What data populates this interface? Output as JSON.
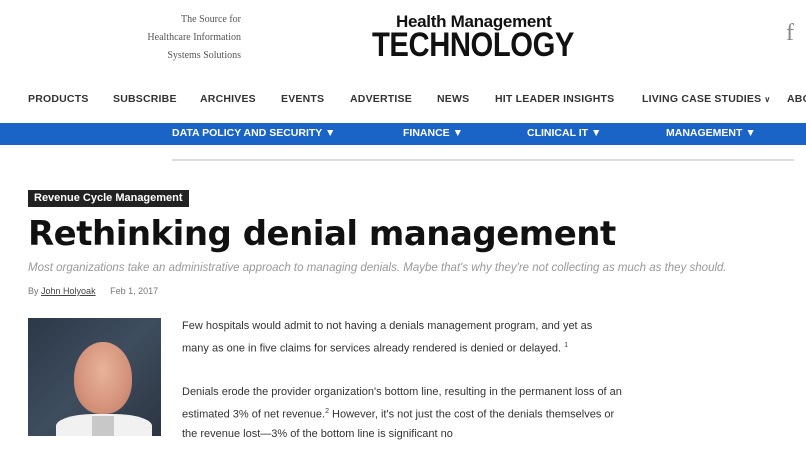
{
  "header": {
    "tagline": [
      "The Source for",
      "Healthcare Information",
      "Systems Solutions"
    ],
    "logo_top": "Health Management",
    "logo_bottom": "TECHNOLOGY",
    "social_icon": "f"
  },
  "main_nav": {
    "items": [
      "PRODUCTS",
      "SUBSCRIBE",
      "ARCHIVES",
      "EVENTS",
      "ADVERTISE",
      "NEWS",
      "HIT LEADER INSIGHTS",
      "LIVING CASE STUDIES",
      "ABO"
    ],
    "caret": "∨"
  },
  "category_nav": {
    "items": [
      "DATA POLICY AND SECURITY ▼",
      "FINANCE ▼",
      "CLINICAL IT ▼",
      "MANAGEMENT ▼"
    ]
  },
  "article": {
    "tag": "Revenue Cycle Management",
    "title": "Rethinking denial management",
    "subtitle": "Most organizations take an administrative approach to managing denials. Maybe that's why they're not collecting as much as they should.",
    "byline_prefix": "By",
    "author": "John Holyoak",
    "date": "Feb 1, 2017",
    "paragraphs": [
      {
        "text": "Few hospitals would admit to not having a denials management program, and yet as many as one in five claims for services already rendered is denied or delayed.",
        "sup": "1"
      },
      {
        "text_a": "Denials erode the provider organization's bottom line, resulting in the permanent loss of an estimated 3% of net revenue.",
        "sup": "2",
        "text_b": " However, it's not just the cost of the denials themselves or the revenue lost—3% of the bottom line is significant no"
      }
    ]
  },
  "colors": {
    "accent_blue": "#1a63c7",
    "tag_bg": "#222222"
  }
}
